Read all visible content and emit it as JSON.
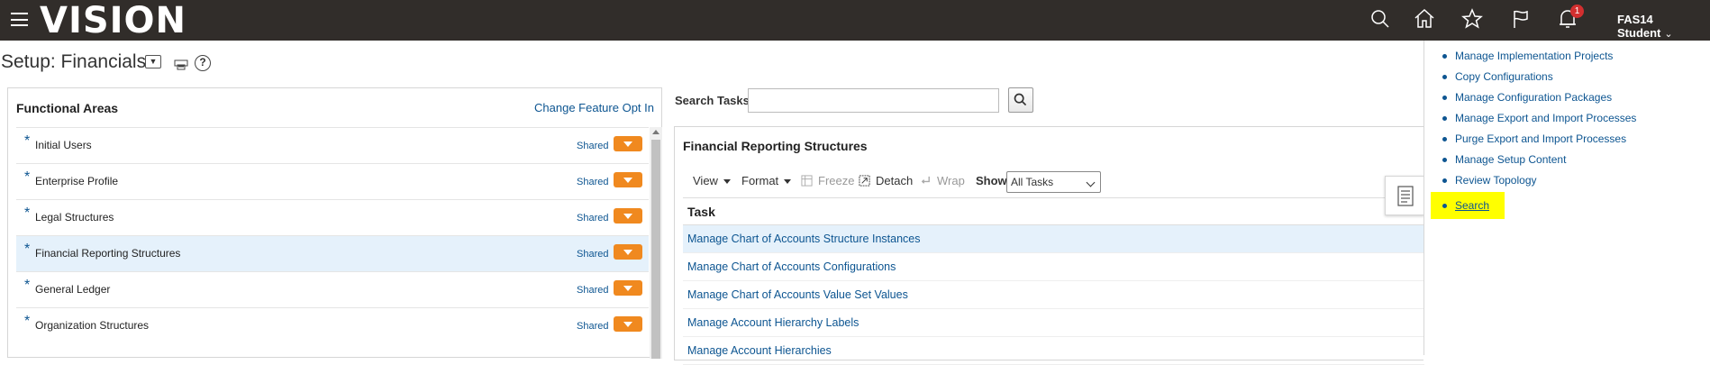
{
  "topbar": {
    "logo": "VISION",
    "notifications_count": "1",
    "user_name": "FAS14 Student"
  },
  "page": {
    "title": "Setup: Financials"
  },
  "functional_areas": {
    "header": "Functional Areas",
    "link": "Change Feature Opt In",
    "items": [
      {
        "label": "Initial Users",
        "status": "Shared"
      },
      {
        "label": "Enterprise Profile",
        "status": "Shared"
      },
      {
        "label": "Legal Structures",
        "status": "Shared"
      },
      {
        "label": "Financial Reporting Structures",
        "status": "Shared"
      },
      {
        "label": "General Ledger",
        "status": "Shared"
      },
      {
        "label": "Organization Structures",
        "status": "Shared"
      }
    ]
  },
  "search": {
    "label": "Search Tasks",
    "value": ""
  },
  "tasks": {
    "title": "Financial Reporting Structures",
    "toolbar": {
      "view": "View",
      "format": "Format",
      "freeze": "Freeze",
      "detach": "Detach",
      "wrap": "Wrap",
      "show": "Show",
      "show_value": "All Tasks"
    },
    "column": "Task",
    "rows": [
      "Manage Chart of Accounts Structure Instances",
      "Manage Chart of Accounts Configurations",
      "Manage Chart of Accounts Value Set Values",
      "Manage Account Hierarchy Labels",
      "Manage Account Hierarchies"
    ]
  },
  "side_panel": {
    "items": [
      "Manage Implementation Projects",
      "Copy Configurations",
      "Manage Configuration Packages",
      "Manage Export and Import Processes",
      "Purge Export and Import Processes",
      "Manage Setup Content",
      "Review Topology",
      "Search"
    ]
  },
  "colors": {
    "topbar": "#312d2a",
    "link": "#0d5591",
    "accent_orange": "#f0891f",
    "selected_row": "#e5f1fb",
    "highlight": "#ffff00"
  }
}
